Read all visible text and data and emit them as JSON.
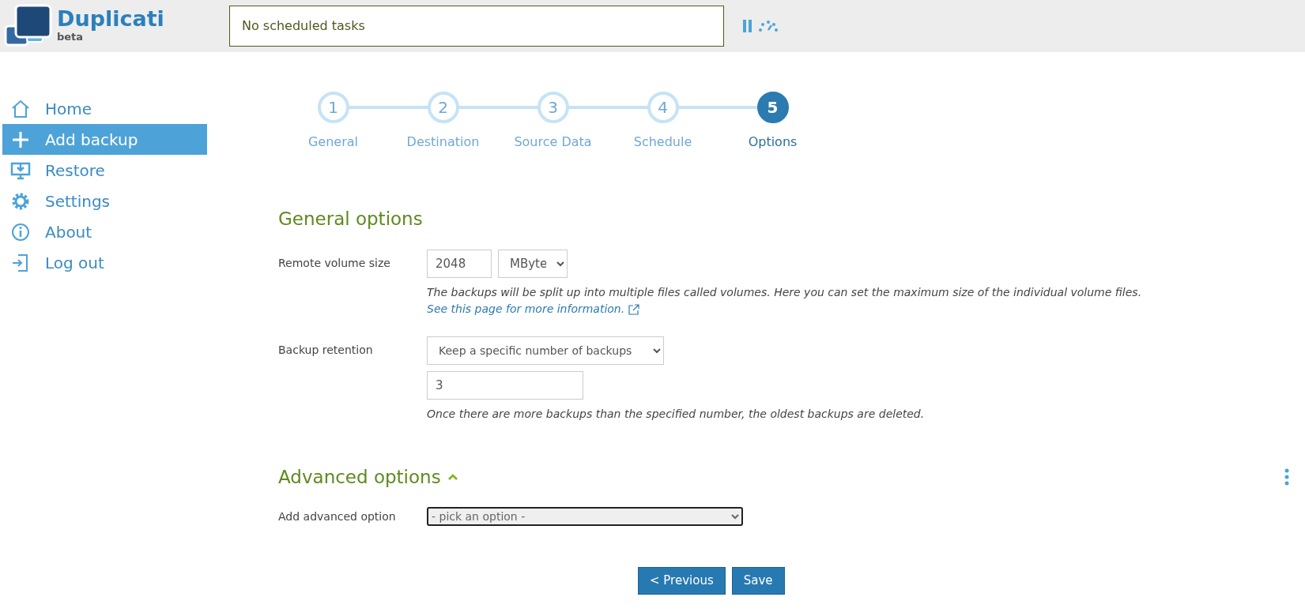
{
  "header": {
    "logo_title": "Duplicati",
    "logo_subtitle": "beta",
    "status": "No scheduled tasks"
  },
  "sidebar": {
    "items": [
      {
        "kind": "home",
        "label": "Home",
        "selected": false
      },
      {
        "kind": "add",
        "label": "Add backup",
        "selected": true
      },
      {
        "kind": "restore",
        "label": "Restore",
        "selected": false
      },
      {
        "kind": "settings",
        "label": "Settings",
        "selected": false
      },
      {
        "kind": "about",
        "label": "About",
        "selected": false
      },
      {
        "kind": "logout",
        "label": "Log out",
        "selected": false
      }
    ]
  },
  "steps": [
    {
      "number": "1",
      "label": "General",
      "selected": false
    },
    {
      "number": "2",
      "label": "Destination",
      "selected": false
    },
    {
      "number": "3",
      "label": "Source Data",
      "selected": false
    },
    {
      "number": "4",
      "label": "Schedule",
      "selected": false
    },
    {
      "number": "5",
      "label": "Options",
      "selected": true
    }
  ],
  "general_options": {
    "title": "General options",
    "remote_volume_size": {
      "label": "Remote volume size",
      "value": "2048",
      "unit": "MByte",
      "help": "The backups will be split up into multiple files called volumes. Here you can set the maximum size of the individual volume files.",
      "link": "See this page for more information."
    },
    "backup_retention": {
      "label": "Backup retention",
      "value": "Keep a specific number of backups",
      "count": "3",
      "help": "Once there are more backups than the specified number, the oldest backups are deleted."
    }
  },
  "advanced_options": {
    "title": "Advanced options",
    "expanded": true,
    "add_label": "Add advanced option",
    "add_value": "- pick an option -"
  },
  "buttons": [
    {
      "label": "< Previous"
    },
    {
      "label": "Save"
    }
  ]
}
